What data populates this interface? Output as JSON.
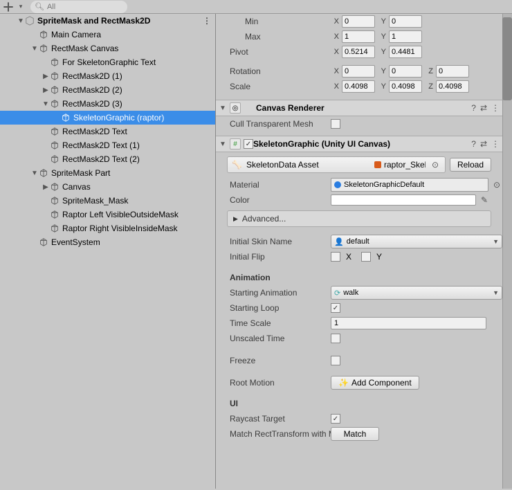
{
  "toolbar": {
    "search_placeholder": "All"
  },
  "hierarchy": {
    "scene": "SpriteMask and RectMask2D",
    "items": [
      {
        "depth": 0,
        "label": "Main Camera",
        "fold": ""
      },
      {
        "depth": 0,
        "label": "RectMask Canvas",
        "fold": "down"
      },
      {
        "depth": 1,
        "label": "For SkeletonGraphic Text",
        "fold": ""
      },
      {
        "depth": 1,
        "label": "RectMask2D (1)",
        "fold": "right"
      },
      {
        "depth": 1,
        "label": "RectMask2D (2)",
        "fold": "right"
      },
      {
        "depth": 1,
        "label": "RectMask2D (3)",
        "fold": "down"
      },
      {
        "depth": 2,
        "label": "SkeletonGraphic (raptor)",
        "fold": "",
        "selected": true
      },
      {
        "depth": 1,
        "label": "RectMask2D Text",
        "fold": ""
      },
      {
        "depth": 1,
        "label": "RectMask2D Text (1)",
        "fold": ""
      },
      {
        "depth": 1,
        "label": "RectMask2D Text (2)",
        "fold": ""
      },
      {
        "depth": 0,
        "label": "SpriteMask Part",
        "fold": "down"
      },
      {
        "depth": 1,
        "label": "Canvas",
        "fold": "right"
      },
      {
        "depth": 1,
        "label": "SpriteMask_Mask",
        "fold": ""
      },
      {
        "depth": 1,
        "label": "Raptor Left VisibleOutsideMask",
        "fold": ""
      },
      {
        "depth": 1,
        "label": "Raptor Right VisibleInsideMask",
        "fold": ""
      },
      {
        "depth": 0,
        "label": "EventSystem",
        "fold": ""
      }
    ]
  },
  "transform": {
    "min_label": "Min",
    "min": {
      "x": "0",
      "y": "0"
    },
    "max_label": "Max",
    "max": {
      "x": "1",
      "y": "1"
    },
    "pivot_label": "Pivot",
    "pivot": {
      "x": "0.5214",
      "y": "0.4481"
    },
    "rotation_label": "Rotation",
    "rotation": {
      "x": "0",
      "y": "0",
      "z": "0"
    },
    "scale_label": "Scale",
    "scale": {
      "x": "0.4098",
      "y": "0.4098",
      "z": "0.4098"
    }
  },
  "canvas_renderer": {
    "title": "Canvas Renderer",
    "cull_label": "Cull Transparent Mesh",
    "cull_checked": false
  },
  "skeleton_graphic": {
    "title": "SkeletonGraphic (Unity UI Canvas)",
    "enabled": true,
    "data_asset_label": "SkeletonData Asset",
    "data_asset_value": "raptor_SkeletonData",
    "reload_label": "Reload",
    "material_label": "Material",
    "material_value": "SkeletonGraphicDefault",
    "color_label": "Color",
    "advanced_label": "Advanced...",
    "initial_skin_label": "Initial Skin Name",
    "initial_skin_value": "default",
    "initial_flip_label": "Initial Flip",
    "flip_x": false,
    "flip_y": false,
    "animation_header": "Animation",
    "starting_anim_label": "Starting Animation",
    "starting_anim_value": "walk",
    "starting_loop_label": "Starting Loop",
    "starting_loop": true,
    "time_scale_label": "Time Scale",
    "time_scale": "1",
    "unscaled_time_label": "Unscaled Time",
    "unscaled_time": false,
    "freeze_label": "Freeze",
    "freeze": false,
    "root_motion_label": "Root Motion",
    "root_motion_btn": "Add Component",
    "ui_header": "UI",
    "raycast_label": "Raycast Target",
    "raycast": true,
    "match_rect_label": "Match RectTransform with Mesh",
    "match_btn": "Match"
  }
}
